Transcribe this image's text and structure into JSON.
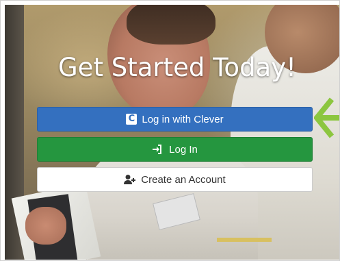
{
  "hero": {
    "title": "Get Started Today!"
  },
  "buttons": {
    "clever": {
      "label": "Log in with Clever",
      "icon": "clever-logo-icon",
      "color": "#3470bf"
    },
    "login": {
      "label": "Log In",
      "icon": "sign-in-icon",
      "color": "#25963f"
    },
    "create": {
      "label": "Create an Account",
      "icon": "user-plus-icon",
      "color": "#ffffff"
    }
  },
  "annotation": {
    "icon": "arrow-left-icon",
    "color": "#8cc63f"
  }
}
